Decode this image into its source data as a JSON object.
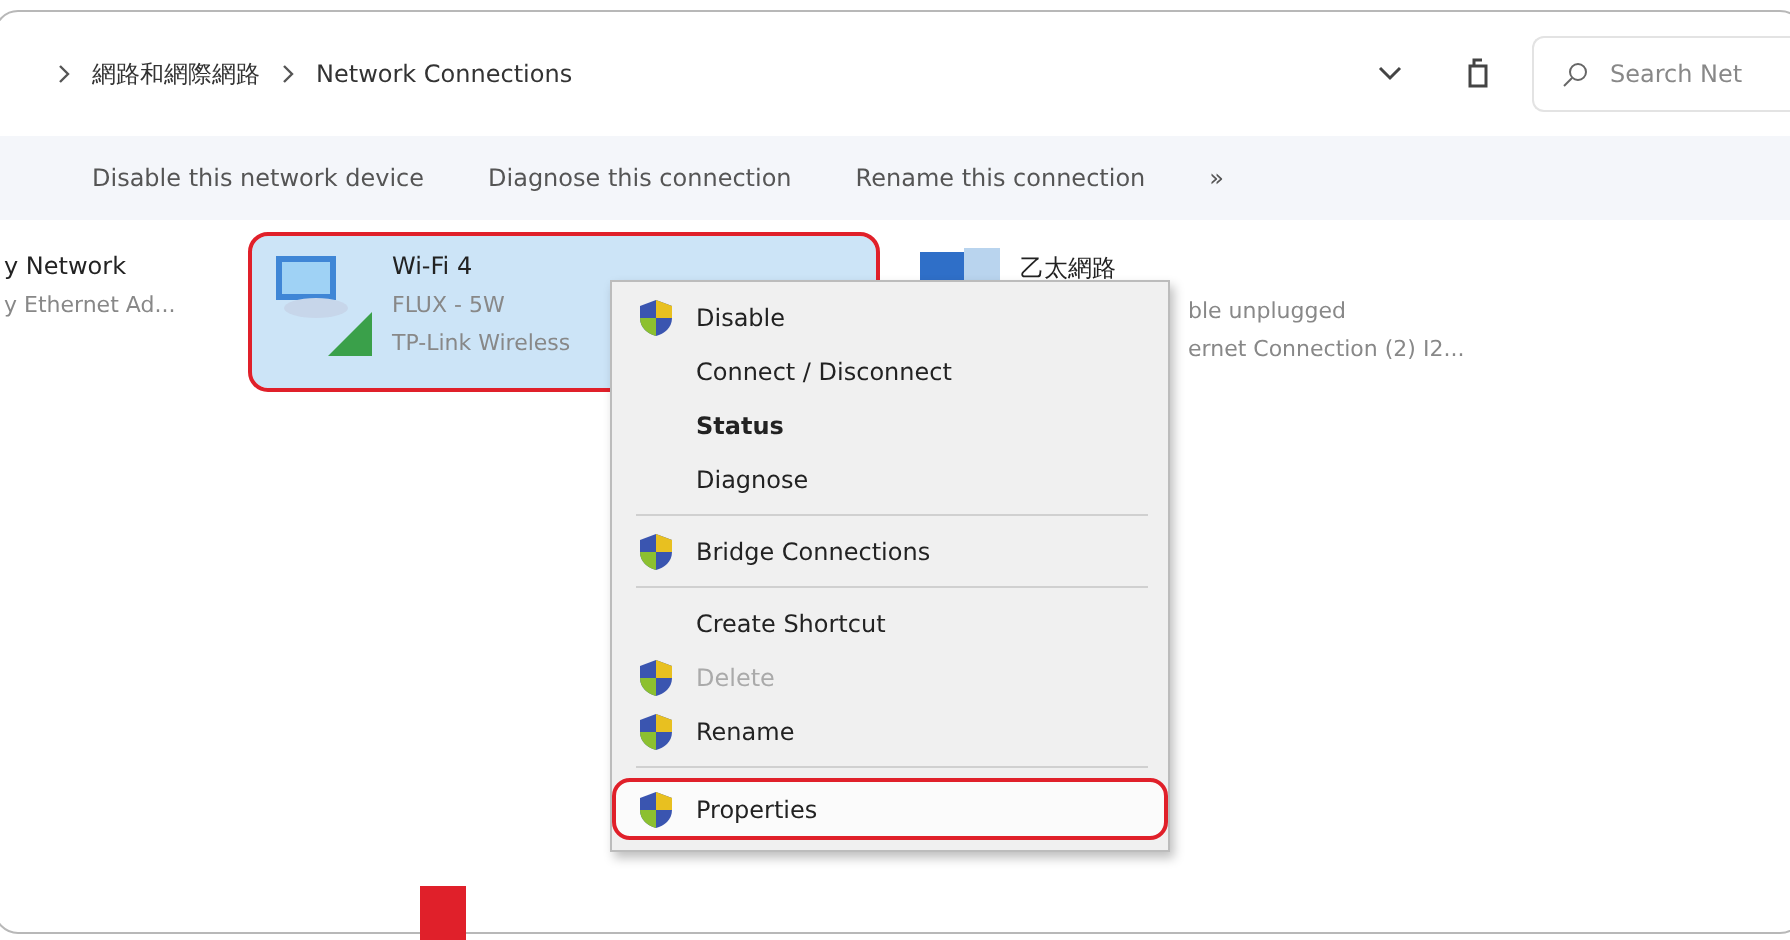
{
  "address_bar": {
    "breadcrumb": [
      "網路和網際網路",
      "Network Connections"
    ]
  },
  "search": {
    "placeholder": "Search Net"
  },
  "toolbar": {
    "buttons": [
      "Disable this network device",
      "Diagnose this connection",
      "Rename this connection"
    ],
    "overflow": "»"
  },
  "connections": [
    {
      "kind": "partial",
      "name": "y Network",
      "lines": [
        "y Ethernet Ad..."
      ],
      "selected": false,
      "highlighted": false
    },
    {
      "kind": "wifi",
      "name": "Wi-Fi 4",
      "lines": [
        "FLUX - 5W",
        "TP-Link Wireless"
      ],
      "selected": true,
      "highlighted": true
    },
    {
      "kind": "ethernet",
      "name": "乙太網路",
      "lines": [
        "ble unplugged",
        "ernet Connection (2) I2..."
      ],
      "selected": false,
      "highlighted": false
    }
  ],
  "context_menu": [
    {
      "kind": "item",
      "label": "Disable",
      "shield": true,
      "bold": false,
      "disabled": false,
      "highlighted": false
    },
    {
      "kind": "item",
      "label": "Connect / Disconnect",
      "shield": false,
      "bold": false,
      "disabled": false,
      "highlighted": false
    },
    {
      "kind": "item",
      "label": "Status",
      "shield": false,
      "bold": true,
      "disabled": false,
      "highlighted": false
    },
    {
      "kind": "item",
      "label": "Diagnose",
      "shield": false,
      "bold": false,
      "disabled": false,
      "highlighted": false
    },
    {
      "kind": "separator"
    },
    {
      "kind": "item",
      "label": "Bridge Connections",
      "shield": true,
      "bold": false,
      "disabled": false,
      "highlighted": false
    },
    {
      "kind": "separator"
    },
    {
      "kind": "item",
      "label": "Create Shortcut",
      "shield": false,
      "bold": false,
      "disabled": false,
      "highlighted": false
    },
    {
      "kind": "item",
      "label": "Delete",
      "shield": true,
      "bold": false,
      "disabled": true,
      "highlighted": false
    },
    {
      "kind": "item",
      "label": "Rename",
      "shield": true,
      "bold": false,
      "disabled": false,
      "highlighted": false
    },
    {
      "kind": "separator"
    },
    {
      "kind": "item",
      "label": "Properties",
      "shield": true,
      "bold": false,
      "disabled": false,
      "highlighted": true
    }
  ]
}
